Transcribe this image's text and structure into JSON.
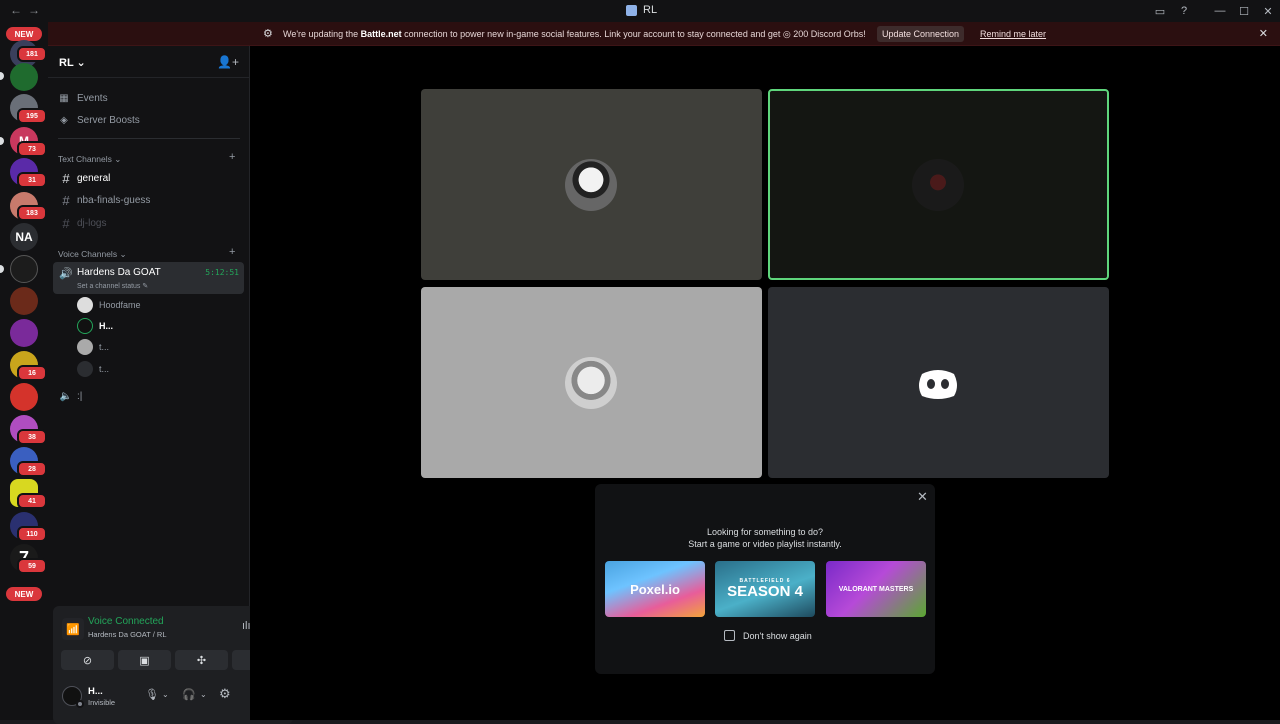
{
  "window": {
    "title": "RL",
    "back_glyph": "←",
    "forward_glyph": "→",
    "inbox_icon": "▭",
    "help_icon": "?",
    "minimize_icon": "—",
    "maximize_icon": "☐",
    "close_icon": "✕"
  },
  "servers": {
    "new_top": "NEW",
    "new_bottom": "NEW",
    "na_label": "NA",
    "seven_label": "7",
    "m_label": "M",
    "badges": [
      "181",
      "195",
      "73",
      "31",
      "183",
      "16",
      "38",
      "28",
      "41",
      "110",
      "59"
    ]
  },
  "banner": {
    "text_before": "We're updating the ",
    "bold": "Battle.net",
    "text_after": " connection to power new in-game social features. Link your account to stay connected and get ",
    "orbs": "200 Discord Orbs!",
    "update_button": "Update Connection",
    "remind_link": "Remind me later"
  },
  "guild": {
    "name": "RL",
    "chevron": "⌄",
    "invite_icon": "👤+"
  },
  "nav": {
    "events": "Events",
    "boosts": "Server Boosts"
  },
  "categories": {
    "text": "Text Channels",
    "voice": "Voice Channels",
    "chevron": "⌄",
    "plus": "+"
  },
  "text_channels": [
    "general",
    "nba-finals-guess",
    "dj-logs"
  ],
  "voice_channel": {
    "name": "Hardens Da GOAT",
    "timer": "5:12:51",
    "status": "Set a channel status ✎"
  },
  "voice_users": [
    "Hoodfame",
    "H...",
    "t...",
    "t..."
  ],
  "other_voice": ":|",
  "voice_panel": {
    "title": "Voice Connected",
    "subtitle": "Hardens Da GOAT / RL"
  },
  "user": {
    "name": "H...",
    "status": "Invisible"
  },
  "popup": {
    "line1": "Looking for something to do?",
    "line2": "Start a game or video playlist instantly.",
    "cards": [
      "Poxel.io",
      "SEASON 4",
      "VALORANT MASTERS"
    ],
    "card_small": "BATTLEFIELD 6",
    "checkbox_label": "Don't show again"
  },
  "colors": {
    "accent_green": "#23a55a",
    "speaking_border": "#5fd67c",
    "badge_red": "#da373c",
    "banner_bg": "#2b0f10"
  }
}
